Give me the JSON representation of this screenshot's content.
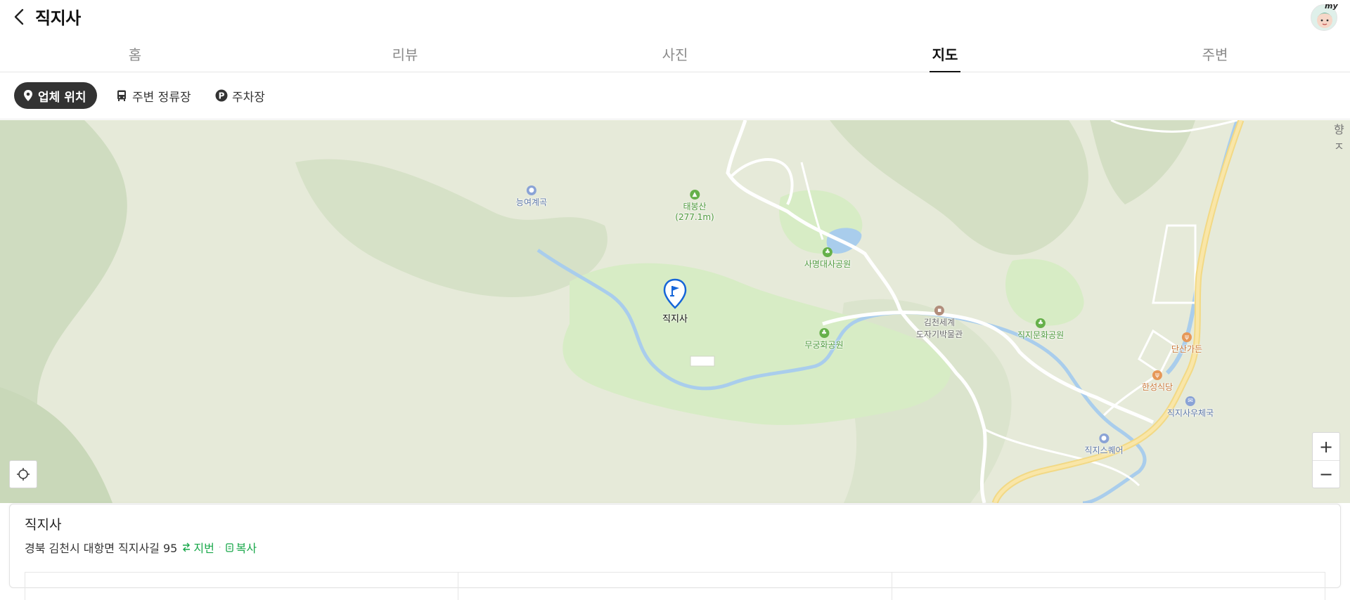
{
  "header": {
    "title": "직지사",
    "avatar_tag": "my"
  },
  "tabs": [
    {
      "label": "홈",
      "active": false
    },
    {
      "label": "리뷰",
      "active": false
    },
    {
      "label": "사진",
      "active": false
    },
    {
      "label": "지도",
      "active": true
    },
    {
      "label": "주변",
      "active": false
    }
  ],
  "filters": {
    "location": "업체 위치",
    "bus": "주변 정류장",
    "parking": "주차장"
  },
  "map": {
    "pin_label": "직지사",
    "edge_label": "향ㅈ",
    "pois": {
      "neungyeo": "능여계곡",
      "taebong_name": "태봉산",
      "taebong_height": "(277.1m)",
      "samyeong": "사명대사공원",
      "mugunghwa": "무궁화공원",
      "museum_1": "김천세계",
      "museum_2": "도자기박물관",
      "jikji_culture": "직지문화공원",
      "dansan": "단산가든",
      "hanseong": "한성식당",
      "post": "직지사우체국",
      "square": "직지스퀘어"
    },
    "zoom_in": "+",
    "zoom_out": "−"
  },
  "card": {
    "name": "직지사",
    "address": "경북 김천시 대항면 직지사길 95",
    "lot_label": "지번",
    "copy_label": "복사"
  },
  "colors": {
    "accent_green": "#19a84a",
    "pin_blue": "#1565d8",
    "road_yellow": "#f5dc8a",
    "river_blue": "#a9cdec"
  }
}
